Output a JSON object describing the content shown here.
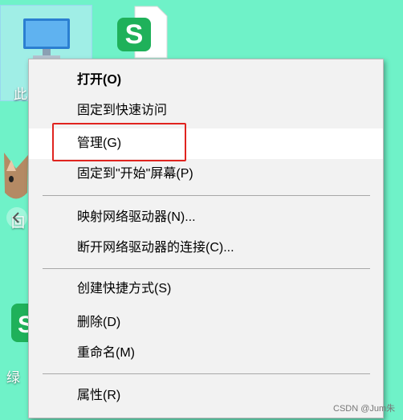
{
  "desktop": {
    "label_this_pc_fragment": "此",
    "label_fragment_2": "回",
    "label_fragment_3": "绿"
  },
  "context_menu": {
    "items": [
      {
        "label": "打开(O)",
        "bold": true
      },
      {
        "label": "固定到快速访问"
      },
      {
        "label": "管理(G)",
        "highlighted": true
      },
      {
        "label": "固定到\"开始\"屏幕(P)"
      },
      {
        "label": "映射网络驱动器(N)..."
      },
      {
        "label": "断开网络驱动器的连接(C)..."
      },
      {
        "label": "创建快捷方式(S)"
      },
      {
        "label": "删除(D)"
      },
      {
        "label": "重命名(M)"
      },
      {
        "label": "属性(R)"
      }
    ]
  },
  "colors": {
    "desktop_bg": "#6ff2c8",
    "highlight_border": "#e0241f",
    "menu_bg": "#f2f2f2",
    "wps_green": "#1fb15a"
  },
  "watermark": "CSDN @Jum朱"
}
